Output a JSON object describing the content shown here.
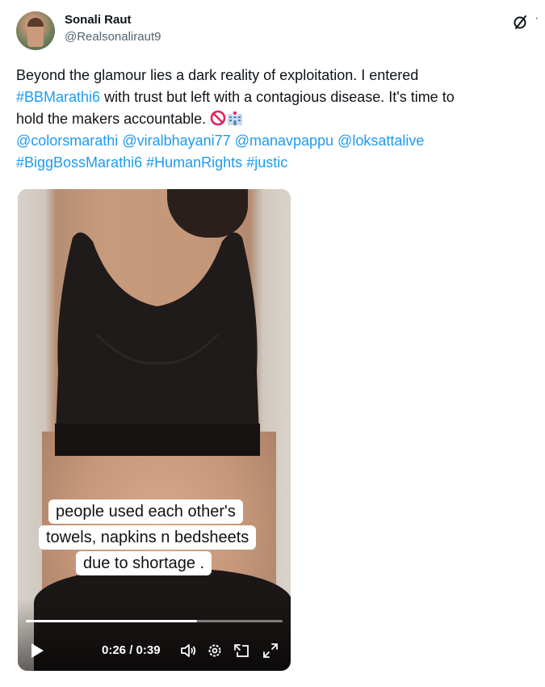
{
  "author": {
    "name": "Sonali Raut",
    "handle": "@Realsonaliraut9"
  },
  "icons": {
    "grok": "grok-icon",
    "more": "more-options-icon",
    "no_entry": "no-entry-emoji",
    "hospital": "hospital-emoji",
    "play": "play-icon",
    "volume": "volume-icon",
    "settings": "settings-icon",
    "pip": "picture-in-picture-icon",
    "fullscreen": "fullscreen-icon"
  },
  "tweet": {
    "line1": "Beyond the glamour lies a dark reality of exploitation. I entered",
    "hashtag1": "#BBMarathi6",
    "line2_rest": " with trust but left with a contagious disease. It's time to",
    "line3": "hold the makers accountable. ",
    "mention1": "@colorsmarathi",
    "mention2": "@viralbhayani77",
    "mention3": "@manavpappu",
    "mention4": "@loksattalive",
    "hashtag2": "#BiggBossMarathi6",
    "hashtag3": "#HumanRights",
    "hashtag4": "#justic"
  },
  "video": {
    "caption_line1": "people used each other's",
    "caption_line2": "towels, napkins n bedsheets",
    "caption_line3": "due to shortage .",
    "time_display": "0:26 / 0:39",
    "progress_fraction": 0.667
  },
  "colors": {
    "link": "#1d9bf0",
    "text": "#0f1419",
    "secondary": "#536471"
  }
}
